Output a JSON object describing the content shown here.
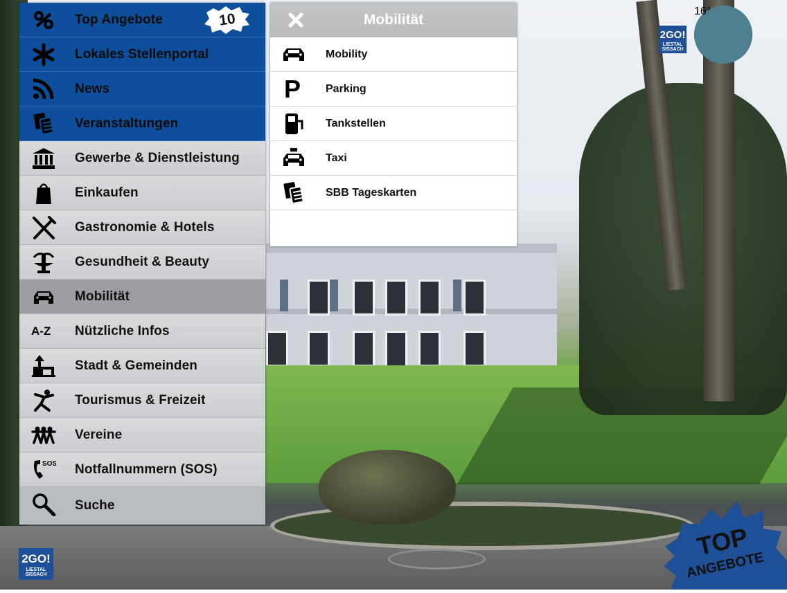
{
  "menu": {
    "items": [
      {
        "label": "Top Angebote",
        "icon": "percent-icon",
        "style": "blue",
        "badge": "10"
      },
      {
        "label": "Lokales Stellenportal",
        "icon": "asterisk-icon",
        "style": "blue"
      },
      {
        "label": "News",
        "icon": "rss-icon",
        "style": "blue"
      },
      {
        "label": "Veranstaltungen",
        "icon": "tickets-icon",
        "style": "blue"
      },
      {
        "label": "Gewerbe & Dienstleistung",
        "icon": "bank-icon",
        "style": "grey"
      },
      {
        "label": "Einkaufen",
        "icon": "shopping-bag-icon",
        "style": "grey"
      },
      {
        "label": "Gastronomie & Hotels",
        "icon": "fork-knife-icon",
        "style": "grey"
      },
      {
        "label": "Gesundheit & Beauty",
        "icon": "fountain-icon",
        "style": "grey"
      },
      {
        "label": "Mobilität",
        "icon": "car-icon",
        "style": "active"
      },
      {
        "label": "Nützliche Infos",
        "icon": "a-z-icon",
        "style": "grey"
      },
      {
        "label": "Stadt & Gemeinden",
        "icon": "town-hall-icon",
        "style": "grey"
      },
      {
        "label": "Tourismus & Freizeit",
        "icon": "person-jumping-icon",
        "style": "grey"
      },
      {
        "label": "Vereine",
        "icon": "people-group-icon",
        "style": "grey"
      },
      {
        "label": "Notfallnummern (SOS)",
        "icon": "phone-sos-icon",
        "style": "grey"
      },
      {
        "label": "Suche",
        "icon": "search-icon",
        "style": "search"
      }
    ],
    "a_z_text": "A-Z",
    "sos_text": "SOS"
  },
  "submenu": {
    "title": "Mobilität",
    "rows": [
      {
        "label": "Mobility",
        "icon": "car-icon"
      },
      {
        "label": "Parking",
        "icon": "parking-icon"
      },
      {
        "label": "Tankstellen",
        "icon": "fuel-pump-icon"
      },
      {
        "label": "Taxi",
        "icon": "taxi-icon"
      },
      {
        "label": "SBB Tageskarten",
        "icon": "tickets-icon"
      }
    ],
    "parking_glyph": "P"
  },
  "weather": {
    "temperature": "16°",
    "icon": "sun-cloud-icon"
  },
  "branding": {
    "logo_big": "2GO!",
    "logo_small": "LIESTAL SISSACH",
    "accent": "#0d4f9a"
  },
  "top_badge": {
    "line1": "TOP",
    "line2": "ANGEBOTE"
  }
}
